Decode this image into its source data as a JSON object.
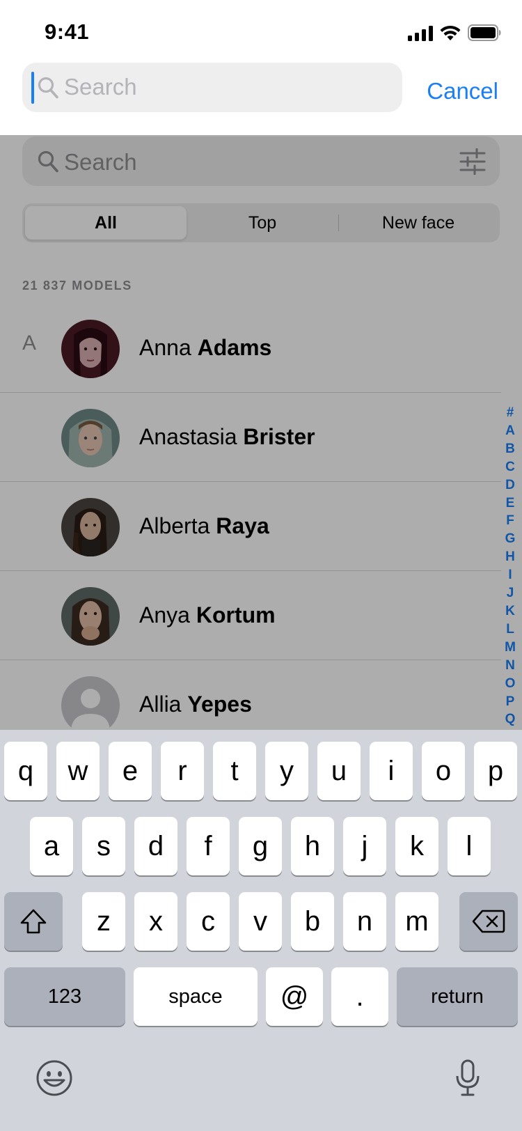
{
  "status_bar": {
    "time": "9:41"
  },
  "search_header": {
    "placeholder": "Search",
    "cancel_label": "Cancel"
  },
  "content": {
    "search_placeholder": "Search",
    "segments": [
      "All",
      "Top",
      "New face"
    ],
    "selected_segment": "All",
    "model_count": "21 837 MODELS",
    "section_letter": "A",
    "models": [
      {
        "first": "Anna",
        "last": "Adams"
      },
      {
        "first": "Anastasia",
        "last": "Brister"
      },
      {
        "first": "Alberta",
        "last": "Raya"
      },
      {
        "first": "Anya",
        "last": "Kortum"
      },
      {
        "first": "Allia",
        "last": "Yepes"
      }
    ],
    "index_letters": [
      "#",
      "A",
      "B",
      "C",
      "D",
      "E",
      "F",
      "G",
      "H",
      "I",
      "J",
      "K",
      "L",
      "M",
      "N",
      "O",
      "P",
      "Q"
    ]
  },
  "keyboard": {
    "row1": [
      "q",
      "w",
      "e",
      "r",
      "t",
      "y",
      "u",
      "i",
      "o",
      "p"
    ],
    "row2": [
      "a",
      "s",
      "d",
      "f",
      "g",
      "h",
      "j",
      "k",
      "l"
    ],
    "row3": [
      "z",
      "x",
      "c",
      "v",
      "b",
      "n",
      "m"
    ],
    "numbers_label": "123",
    "space_label": "space",
    "at_label": "@",
    "dot_label": ".",
    "return_label": "return"
  },
  "colors": {
    "accent": "#1a7ff5",
    "keyboard_bg": "#d1d4db",
    "dim_overlay": "rgba(0,0,0,0.32)"
  }
}
